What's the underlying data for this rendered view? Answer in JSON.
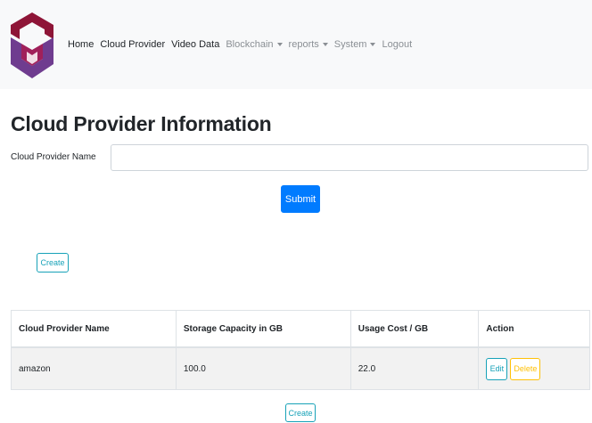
{
  "navbar": {
    "brand_logo": "cube-shield-logo",
    "links": [
      {
        "label": "Home"
      },
      {
        "label": "Cloud Provider"
      },
      {
        "label": "Video Data"
      }
    ],
    "dropdowns": [
      {
        "label": "Blockchain"
      },
      {
        "label": "reports"
      },
      {
        "label": "System"
      }
    ],
    "logout_label": "Logout"
  },
  "page": {
    "title": "Cloud Provider Information"
  },
  "form": {
    "field_label": "Cloud Provider Name",
    "field_value": "",
    "submit_label": "Submit"
  },
  "create_label": "Create",
  "table": {
    "headers": [
      "Cloud Provider Name",
      "Storage Capacity in GB",
      "Usage Cost / GB",
      "Action"
    ],
    "rows": [
      {
        "name": "amazon",
        "capacity": "100.0",
        "cost": "22.0",
        "edit_label": "Edit",
        "delete_label": "Delete"
      }
    ]
  },
  "colors": {
    "primary": "#007bff",
    "info": "#17a2b8",
    "warning": "#ffc107",
    "logo_red": "#8e1537",
    "logo_purple": "#6f3c8f"
  }
}
